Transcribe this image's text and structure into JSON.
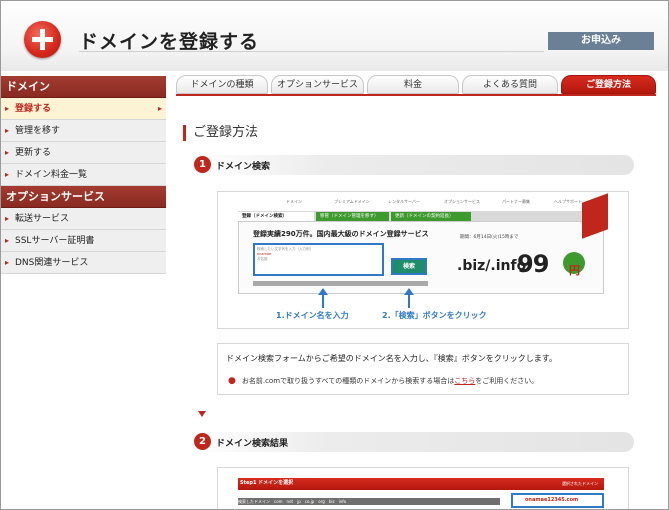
{
  "header": {
    "title": "ドメインを登録する",
    "apply_label": "お申込み"
  },
  "sidebar": {
    "section1": "ドメイン",
    "items1": [
      "登録する",
      "管理を移す",
      "更新する",
      "ドメイン料金一覧"
    ],
    "section2": "オプションサービス",
    "items2": [
      "転送サービス",
      "SSLサーバー証明書",
      "DNS関連サービス"
    ]
  },
  "tabs": [
    "ドメインの種類",
    "オプションサービス",
    "料金",
    "よくある質問",
    "ご登録方法"
  ],
  "main": {
    "title": "ご登録方法",
    "step1": {
      "num": "1",
      "label": "ドメイン検索"
    },
    "step2": {
      "num": "2",
      "label": "ドメイン検索結果"
    },
    "caption1": "1.ドメイン名を入力",
    "caption2": "2.「検索」ボタンをクリック",
    "desc": "ドメイン検索フォームからご希望のドメイン名を入力し、『検索』ボタンをクリックします。",
    "note_pre": "お名前.comで取り扱うすべての種類のドメインから検索する場合は",
    "note_link": "こちら",
    "note_post": "をご利用ください。"
  },
  "mock1": {
    "nav": [
      "ドメイン",
      "プレミアムドメイン",
      "レンタルサーバー",
      "オプションサービス",
      "パートナー募集",
      "ヘルプサポート"
    ],
    "tab_a": "登録（ドメイン検索）",
    "tab_b": "移管（ドメイン管理を移す）",
    "tab_c": "更新（ドメインの契約延長）",
    "headline": "登録実績290万件。国内最大級のドメイン登録サービス",
    "field_hint": "検索したい文字列を入力（入力例）",
    "field_l2": "onamae",
    "field_l3": "お名前",
    "search_label": "検索",
    "promo_small": "期間：6月14日(火)15時まで",
    "biz": ".biz/.info",
    "price": "99",
    "yen": "円"
  },
  "mock2": {
    "step_label": "Step1 ドメインを選択",
    "row_label": "検索したドメイン　com　net　jp　co.jp　org　biz　info",
    "selected_label": "選択されたドメイン",
    "selected_value": "onamae12345.com"
  },
  "colors": {
    "accent": "#c0271c",
    "blue": "#2f79c7",
    "sidebar_head": "#8a2a21",
    "apply": "#6b8094"
  }
}
